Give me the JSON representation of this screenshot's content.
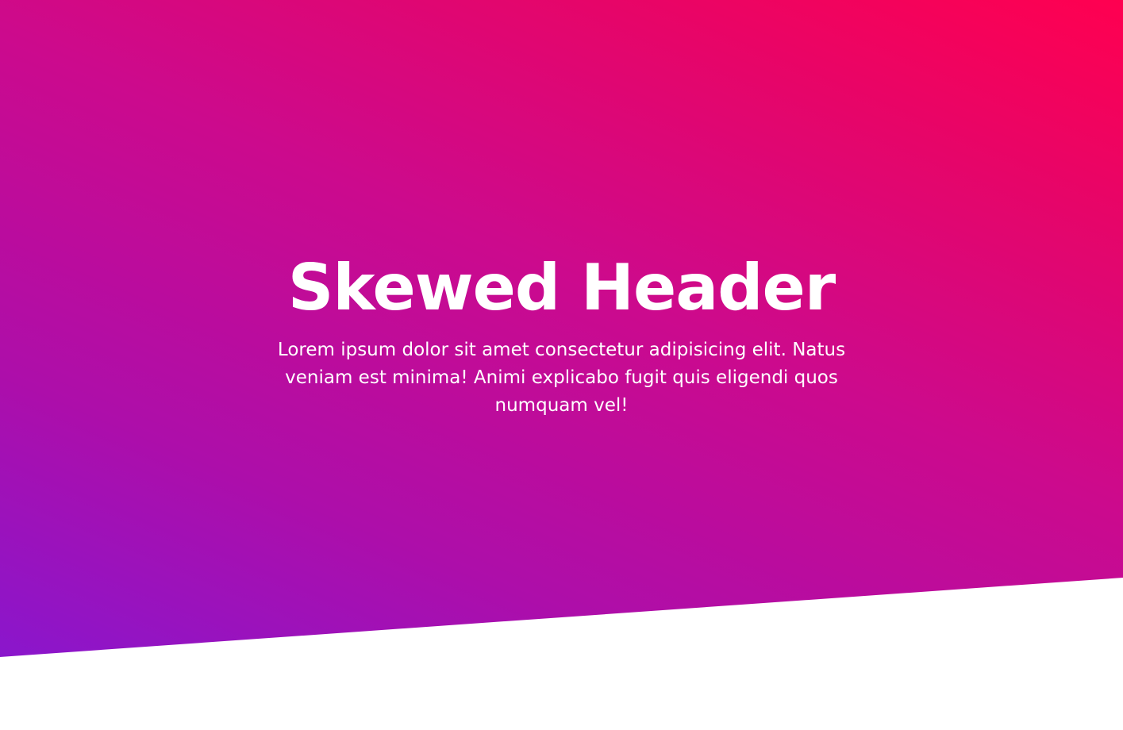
{
  "hero": {
    "title": "Skewed Header",
    "description": "Lorem ipsum dolor sit amet consectetur adipisicing elit. Natus veniam est minima! Animi explicabo fugit quis eligendi quos numquam vel!",
    "gradient_colors": [
      "#8a16cc",
      "#ad0eaa",
      "#cc0a8d",
      "#e60569",
      "#ff0050"
    ]
  }
}
